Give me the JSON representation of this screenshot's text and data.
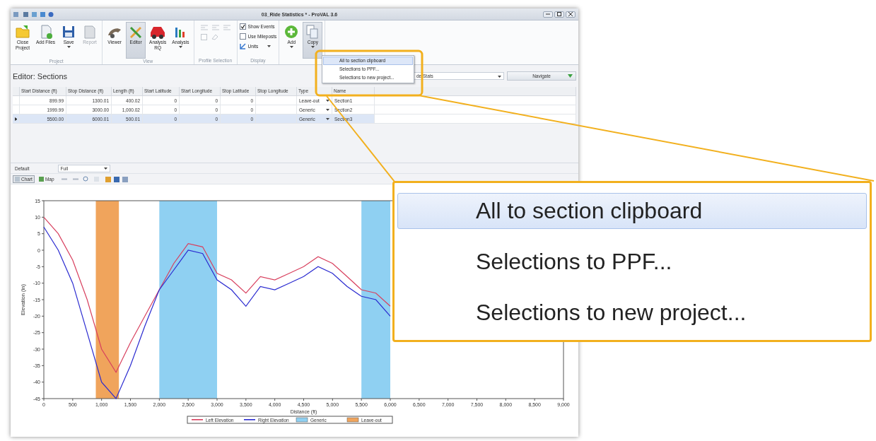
{
  "window": {
    "title": "03_Ride Statistics * - ProVAL 3.6"
  },
  "ribbon": [
    {
      "label": "Project",
      "items": [
        {
          "kind": "large",
          "label": "Close\nProject",
          "dropdown": false,
          "disabled": false,
          "selected": false
        },
        {
          "kind": "large",
          "label": "Add Files",
          "dropdown": false,
          "disabled": false,
          "selected": false
        },
        {
          "kind": "large",
          "label": "Save",
          "dropdown": true,
          "disabled": false,
          "selected": false
        },
        {
          "kind": "large",
          "label": "Report",
          "dropdown": false,
          "disabled": true,
          "selected": false
        }
      ]
    },
    {
      "label": "View",
      "items": [
        {
          "kind": "large",
          "label": "Viewer",
          "dropdown": false,
          "disabled": false,
          "selected": false
        },
        {
          "kind": "large",
          "label": "Editor",
          "dropdown": false,
          "disabled": false,
          "selected": true
        },
        {
          "kind": "large",
          "label": "Analysis\nRQ",
          "dropdown": false,
          "disabled": false,
          "selected": false
        },
        {
          "kind": "large",
          "label": "Analysis",
          "dropdown": true,
          "disabled": false,
          "selected": false
        }
      ]
    },
    {
      "label": "Profile Selection",
      "items": [
        {
          "kind": "iconset",
          "disabled": true
        }
      ]
    },
    {
      "label": "Display",
      "items": [
        {
          "kind": "check",
          "label": "Show Events",
          "checked": true
        },
        {
          "kind": "check",
          "label": "Use Mileposts",
          "checked": false
        },
        {
          "kind": "menu",
          "label": "Units"
        }
      ]
    },
    {
      "items": [
        {
          "kind": "large",
          "label": "Add",
          "dropdown": true,
          "disabled": false,
          "selected": false
        },
        {
          "kind": "large",
          "label": "Copy",
          "dropdown": true,
          "disabled": false,
          "selected": true
        }
      ]
    }
  ],
  "copy_menu": {
    "items": [
      {
        "label": "All to section clipboard",
        "selected": true
      },
      {
        "label": "Selections to PPF...",
        "selected": false
      },
      {
        "label": "Selections to new project...",
        "selected": false
      }
    ]
  },
  "editor": {
    "title": "Editor: Sections",
    "view_select": {
      "value": "de Stats"
    },
    "navigate": "Navigate",
    "table": {
      "columns": [
        {
          "label": "Start Distance (ft)",
          "kind": "number"
        },
        {
          "label": "Stop Distance (ft)",
          "kind": "number"
        },
        {
          "label": "Length (ft)",
          "kind": "number"
        },
        {
          "label": "Start Latitude",
          "kind": "number"
        },
        {
          "label": "Start Longitude",
          "kind": "number"
        },
        {
          "label": "Stop Latitude",
          "kind": "number"
        },
        {
          "label": "Stop Longitude",
          "kind": "number"
        },
        {
          "label": "Type",
          "kind": "dropdown"
        },
        {
          "label": "Name",
          "kind": "text"
        }
      ],
      "rows": [
        {
          "selected": false,
          "cells": [
            "899.99",
            "1300.01",
            "400.02",
            "0",
            "0",
            "0",
            "",
            "Leave-out",
            "Section1"
          ]
        },
        {
          "selected": false,
          "cells": [
            "1999.99",
            "3000.00",
            "1,000.02",
            "0",
            "0",
            "0",
            "",
            "Generic",
            "Section2"
          ]
        },
        {
          "selected": true,
          "cells": [
            "5500.00",
            "6000.01",
            "500.01",
            "0",
            "0",
            "0",
            "",
            "Generic",
            "Section3"
          ]
        }
      ]
    }
  },
  "chart_panel": {
    "profile_label": "Default",
    "range_select": {
      "value": "Full"
    },
    "tabs": [
      {
        "label": "Chart",
        "selected": true
      },
      {
        "label": "Map",
        "selected": false
      }
    ],
    "chart_data": {
      "type": "line",
      "xlabel": "Distance (ft)",
      "ylabel": "Elevation (in)",
      "x": [
        0,
        250,
        500,
        750,
        1000,
        1250,
        1500,
        1750,
        2000,
        2250,
        2500,
        2750,
        3000,
        3250,
        3500,
        3750,
        4000,
        4250,
        4500,
        4750,
        5000,
        5250,
        5500,
        5750,
        6000
      ],
      "series": [
        {
          "name": "Left Elevation",
          "color": "#d8405e",
          "values": [
            10,
            5,
            -3,
            -15,
            -30,
            -37,
            -28,
            -20,
            -12,
            -4,
            2,
            1,
            -7,
            -9,
            -13,
            -8,
            -9,
            -7,
            -5,
            -2,
            -4,
            -8,
            -12,
            -13,
            -17
          ]
        },
        {
          "name": "Right Elevation",
          "color": "#2a2ad0",
          "values": [
            7,
            0,
            -10,
            -25,
            -40,
            -45,
            -35,
            -23,
            -12,
            -6,
            0,
            -1,
            -9,
            -12,
            -17,
            -11,
            -12,
            -10,
            -8,
            -5,
            -7,
            -11,
            -14,
            -15,
            -20
          ]
        }
      ],
      "xlim": [
        0,
        9000
      ],
      "ylim": [
        -45,
        15
      ],
      "xticks": [
        0,
        {
          "value": 500,
          "label": "500"
        },
        {
          "value": 1000,
          "label": "1,000"
        },
        {
          "value": 1500,
          "label": "1,500"
        },
        {
          "value": 2000,
          "label": "2,000"
        },
        {
          "value": 2500,
          "label": "2,500"
        },
        {
          "value": 3000,
          "label": "3,000"
        },
        {
          "value": 3500,
          "label": "3,500"
        },
        {
          "value": 4000,
          "label": "4,000"
        },
        {
          "value": 4500,
          "label": "4,500"
        },
        {
          "value": 5000,
          "label": "5,000"
        },
        {
          "value": 5500,
          "label": "5,500"
        },
        {
          "value": 6000,
          "label": "6,000"
        },
        {
          "value": 6500,
          "label": "6,500"
        },
        {
          "value": 7000,
          "label": "7,000"
        },
        {
          "value": 7500,
          "label": "7,500"
        },
        {
          "value": 8000,
          "label": "8,000"
        },
        {
          "value": 8500,
          "label": "8,500"
        },
        {
          "value": 9000,
          "label": "9,000"
        }
      ],
      "yticks": [
        -45,
        -40,
        -35,
        -30,
        -25,
        -20,
        -15,
        -10,
        -5,
        0,
        5,
        10,
        15
      ],
      "bands": [
        {
          "axis": "x",
          "from": 900,
          "to": 1300,
          "color": "#f0a45c"
        },
        {
          "axis": "x",
          "from": 2000,
          "to": 3000,
          "color": "#8fd0f2"
        },
        {
          "axis": "x",
          "from": 5500,
          "to": 6000,
          "color": "#8fd0f2"
        }
      ],
      "legend": {
        "entries": [
          {
            "label": "Generic",
            "color": "#8fd0f2"
          },
          {
            "label": "Leave-out",
            "color": "#f0a45c"
          }
        ]
      }
    }
  },
  "callout": {
    "items": [
      {
        "label": "All to section clipboard",
        "selected": true
      },
      {
        "label": "Selections to PPF...",
        "selected": false
      },
      {
        "label": "Selections to new project...",
        "selected": false
      }
    ]
  }
}
